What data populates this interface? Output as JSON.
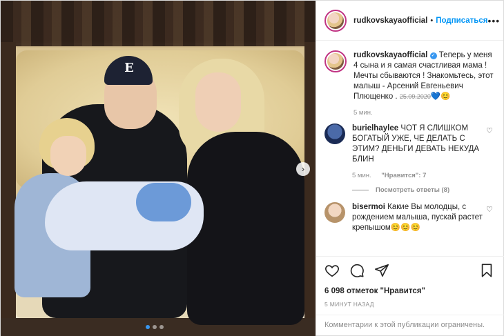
{
  "post": {
    "username": "rudkovskayaofficial",
    "follow_label": "Подписаться",
    "more_icon": "more-horizontal-icon",
    "photo": {
      "cap_letter": "E",
      "carousel_dots": 3,
      "active_dot": 0
    }
  },
  "caption": {
    "username": "rudkovskayaofficial",
    "text": "Теперь у меня 4 сына и я самая счастливая мама ! Мечты сбываются ! Знакомьтесь, этот малыш - Арсений Евгеньевич Плющенко .",
    "date_struck": "25.09.2020",
    "emoji": "💙😊",
    "time": "5 мин."
  },
  "comments": [
    {
      "username": "burielhaylee",
      "text": "ЧОТ Я СЛИШКОМ БОГАТЫЙ УЖЕ, ЧЕ ДЕЛАТЬ С ЭТИМ? ДЕНЬГИ ДЕВАТЬ НЕКУДА БЛИН",
      "time": "5 мин.",
      "likes": "\"Нравится\": 7",
      "replies_label": "Посмотреть ответы (8)"
    },
    {
      "username": "bisermoi",
      "text": "Какие Вы молодцы, с рождением малыша, пускай растет крепышом",
      "emoji": "😊😊😊"
    }
  ],
  "actions": {
    "likes_count": "6 098 отметок \"Нравится\"",
    "time_ago": "5 МИНУТ НАЗАД",
    "comments_closed": "Комментарии к этой публикации ограничены."
  },
  "colors": {
    "accent": "#0095f6",
    "muted": "#8e8e8e",
    "text": "#262626"
  }
}
